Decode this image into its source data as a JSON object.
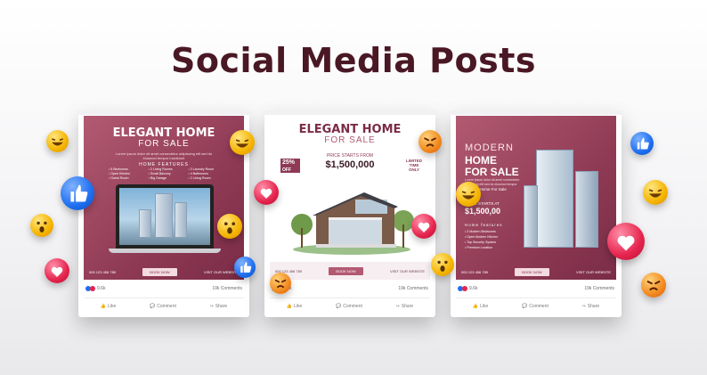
{
  "page_title": "Social Media Posts",
  "colors": {
    "maroon": "#8f3a55",
    "title": "#4a1825",
    "facebook_blue": "#1e6ff0"
  },
  "posts": [
    {
      "title": "ELEGANT HOME",
      "subtitle": "FOR SALE",
      "description": "Lorem ipsum dolor sit amet consectetur adipiscing elit sed do eiusmod tempor incididunt",
      "features_heading": "HOME FEATURES",
      "features": [
        "5 Bedrooms",
        "2 Living Rooms",
        "3 Laundry Room",
        "Open Kitchen",
        "Small Balcony",
        "4 Bathrooms",
        "Guest Room",
        "Big Garage",
        "2 Living Room"
      ],
      "phone": "000 123 456 789",
      "button": "BOOK NOW",
      "website": "VISIT OUR WEBSITE",
      "likes": "9.6k",
      "comments": "19k Comments"
    },
    {
      "title": "ELEGANT HOME",
      "subtitle": "FOR SALE",
      "discount": "25%",
      "discount_label": "OFF",
      "price_label": "PRICE STARTS FROM",
      "price": "$1,500,000",
      "limited": "LIMITED TIME ONLY",
      "phone": "000 123 456 789",
      "button": "BOOK NOW",
      "website": "VISIT OUR WEBSITE",
      "likes": "9.6k",
      "comments": "19k Comments"
    },
    {
      "modern": "MODERN",
      "home": "HOME",
      "for_sale": "FOR SALE",
      "description": "Lorem ipsum dolor sit amet consectetur adipiscing elit sed do eiusmod tempor",
      "modern_line": "Modern Home For Sale",
      "price_label": "PRICE STARTS AT",
      "price": "$1,500,00",
      "features_heading": "Home features",
      "features": [
        "3 Modern Bedrooms",
        "Open Modern Kitchen",
        "Top Security System",
        "Premium Location"
      ],
      "phone": "000 123 456 789",
      "button": "BOOK NOW",
      "website": "VISIT OUR WEBSITE",
      "likes": "9.6k",
      "comments": "19k Comments"
    }
  ],
  "actions": {
    "like": "Like",
    "comment": "Comment",
    "share": "Share"
  },
  "reaction_icons": [
    "laugh-emoji-icon",
    "like-emoji-icon",
    "wow-emoji-icon",
    "heart-emoji-icon",
    "angry-emoji-icon"
  ]
}
